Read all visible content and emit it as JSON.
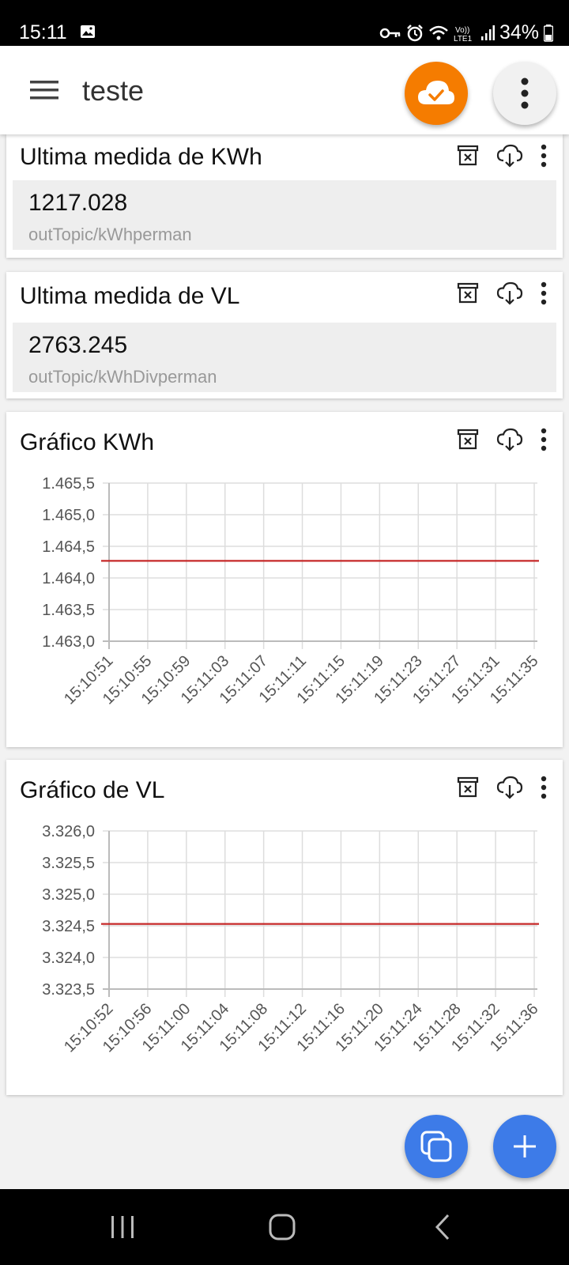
{
  "status_bar": {
    "time": "15:11",
    "battery": "34%"
  },
  "app_bar": {
    "title": "teste",
    "cloud_icon": "cloud-check-icon",
    "menu_icon": "hamburger-menu-icon",
    "more_icon": "more-vert-icon"
  },
  "colors": {
    "accent_orange": "#f57c00",
    "fab_blue": "#3d7be8",
    "series_red": "#c62828"
  },
  "cards": [
    {
      "title": "Ultima medida de KWh",
      "value": "1217.028",
      "topic": "outTopic/kWhperman"
    },
    {
      "title": "Ultima medida de VL",
      "value": "2763.245",
      "topic": "outTopic/kWhDivperman"
    }
  ],
  "charts": [
    {
      "title": "Gráfico KWh"
    },
    {
      "title": "Gráfico de VL"
    }
  ],
  "chart_data": [
    {
      "type": "line",
      "title": "Gráfico KWh",
      "x": [
        "15:10:51",
        "15:10:55",
        "15:10:59",
        "15:11:03",
        "15:11:07",
        "15:11:11",
        "15:11:15",
        "15:11:19",
        "15:11:23",
        "15:11:27",
        "15:11:31",
        "15:11:35"
      ],
      "ytick_labels": [
        "1.465,5",
        "1.465,0",
        "1.464,5",
        "1.464,0",
        "1.463,5",
        "1.463,0"
      ],
      "ylim": [
        1463.0,
        1465.5
      ],
      "grid": true,
      "series": [
        {
          "values": [
            1464.27,
            1464.27,
            1464.27,
            1464.27,
            1464.27,
            1464.27,
            1464.27,
            1464.27,
            1464.27,
            1464.27,
            1464.27,
            1464.27
          ]
        }
      ]
    },
    {
      "type": "line",
      "title": "Gráfico de VL",
      "x": [
        "15:10:52",
        "15:10:56",
        "15:11:00",
        "15:11:04",
        "15:11:08",
        "15:11:12",
        "15:11:16",
        "15:11:20",
        "15:11:24",
        "15:11:28",
        "15:11:32",
        "15:11:36"
      ],
      "ytick_labels": [
        "3.326,0",
        "3.325,5",
        "3.325,0",
        "3.324,5",
        "3.324,0",
        "3.323,5"
      ],
      "ylim": [
        3323.5,
        3326.0
      ],
      "grid": true,
      "series": [
        {
          "values": [
            3324.53,
            3324.53,
            3324.53,
            3324.53,
            3324.53,
            3324.53,
            3324.53,
            3324.53,
            3324.53,
            3324.53,
            3324.53,
            3324.53
          ]
        }
      ]
    }
  ],
  "card_actions": [
    "trash-icon",
    "cloud-download-icon",
    "more-vert-icon"
  ],
  "fabs": {
    "left_icon": "copy-icon",
    "right_icon": "plus-icon"
  },
  "nav": {
    "icons": [
      "recent-apps-icon",
      "home-icon",
      "back-icon"
    ]
  }
}
